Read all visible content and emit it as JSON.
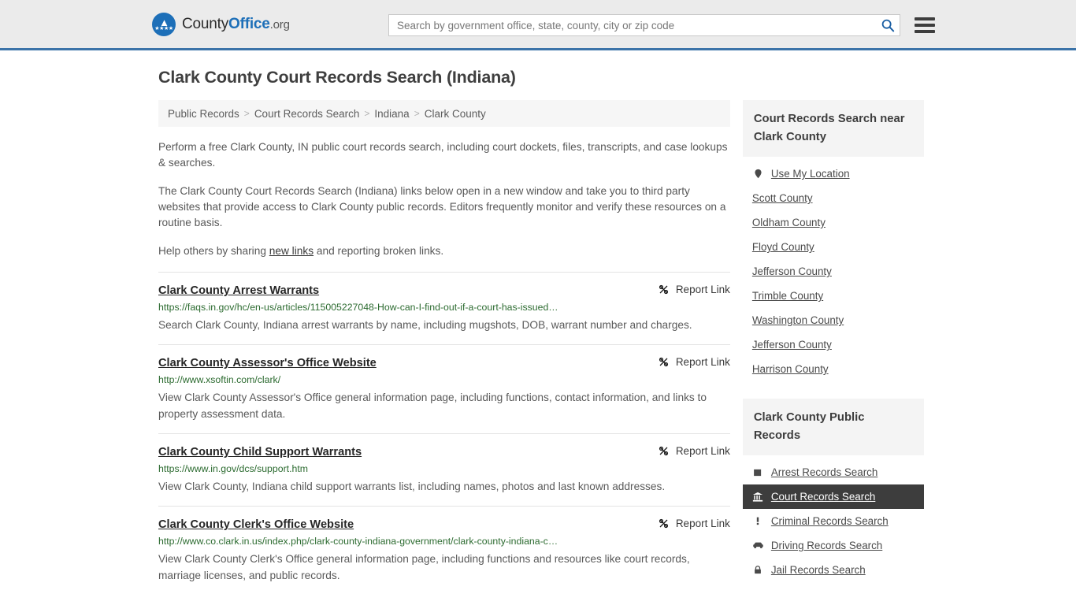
{
  "header": {
    "logo": {
      "part1": "County",
      "part2": "Office",
      "part3": ".org",
      "icon": "eagle-seal-icon"
    },
    "search": {
      "placeholder": "Search by government office, state, county, city or zip code",
      "value": ""
    },
    "search_icon": "search-icon",
    "menu_icon": "hamburger-menu-icon"
  },
  "page": {
    "title": "Clark County Court Records Search (Indiana)"
  },
  "breadcrumb": [
    {
      "label": "Public Records"
    },
    {
      "label": "Court Records Search"
    },
    {
      "label": "Indiana"
    },
    {
      "label": "Clark County"
    }
  ],
  "breadcrumb_separator": ">",
  "intro": {
    "p1": "Perform a free Clark County, IN public court records search, including court dockets, files, transcripts, and case lookups & searches.",
    "p2": "The Clark County Court Records Search (Indiana) links below open in a new window and take you to third party websites that provide access to Clark County public records. Editors frequently monitor and verify these resources on a routine basis.",
    "p3_before": "Help others by sharing ",
    "p3_link": "new links",
    "p3_after": " and reporting broken links."
  },
  "report_link_label": "Report Link",
  "report_link_icon": "broken-link-icon",
  "results": [
    {
      "title": "Clark County Arrest Warrants",
      "url": "https://faqs.in.gov/hc/en-us/articles/115005227048-How-can-I-find-out-if-a-court-has-issued…",
      "description": "Search Clark County, Indiana arrest warrants by name, including mugshots, DOB, warrant number and charges."
    },
    {
      "title": "Clark County Assessor's Office Website",
      "url": "http://www.xsoftin.com/clark/",
      "description": "View Clark County Assessor's Office general information page, including functions, contact information, and links to property assessment data."
    },
    {
      "title": "Clark County Child Support Warrants",
      "url": "https://www.in.gov/dcs/support.htm",
      "description": "View Clark County, Indiana child support warrants list, including names, photos and last known addresses."
    },
    {
      "title": "Clark County Clerk's Office Website",
      "url": "http://www.co.clark.in.us/index.php/clark-county-indiana-government/clark-county-indiana-c…",
      "description": "View Clark County Clerk's Office general information page, including functions and resources like court records, marriage licenses, and public records."
    }
  ],
  "sidebar": {
    "nearby": {
      "title": "Court Records Search near Clark County",
      "use_my_location": {
        "label": "Use My Location",
        "icon": "map-pin-icon"
      },
      "counties": [
        {
          "label": "Scott County"
        },
        {
          "label": "Oldham County"
        },
        {
          "label": "Floyd County"
        },
        {
          "label": "Jefferson County"
        },
        {
          "label": "Trimble County"
        },
        {
          "label": "Washington County"
        },
        {
          "label": "Jefferson County"
        },
        {
          "label": "Harrison County"
        }
      ]
    },
    "public_records": {
      "title": "Clark County Public Records",
      "items": [
        {
          "label": "Arrest Records Search",
          "icon": "square-badge-icon",
          "active": false
        },
        {
          "label": "Court Records Search",
          "icon": "courthouse-icon",
          "active": true
        },
        {
          "label": "Criminal Records Search",
          "icon": "exclamation-icon",
          "active": false
        },
        {
          "label": "Driving Records Search",
          "icon": "car-icon",
          "active": false
        },
        {
          "label": "Jail Records Search",
          "icon": "lock-icon",
          "active": false
        }
      ]
    }
  },
  "colors": {
    "brand_blue": "#1d6fb8",
    "header_border": "#3b73a8",
    "url_green": "#2c6b30",
    "active_bg": "#3d3d3d"
  }
}
